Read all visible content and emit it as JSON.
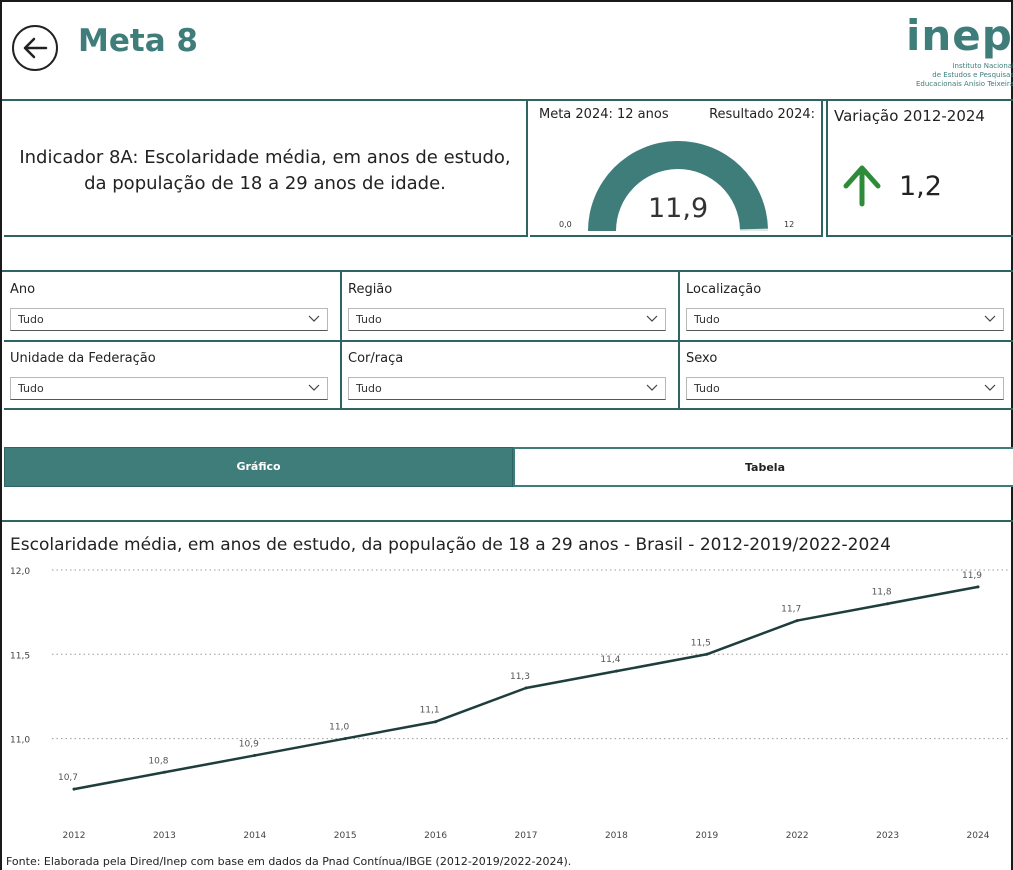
{
  "header": {
    "title": "Meta 8",
    "logo": {
      "mark": "inep",
      "lines": [
        "Instituto Nacional",
        "de Estudos e Pesquisas",
        "Educacionais Anísio Teixeira"
      ]
    }
  },
  "indicator": {
    "text": "Indicador 8A: Escolaridade média, em anos de estudo, da população de 18 a 29 anos de idade."
  },
  "gauge": {
    "meta_label": "Meta 2024: 12 anos",
    "result_label": "Resultado 2024:",
    "min_label": "0,0",
    "max_label": "12",
    "value_label": "11,9",
    "value": 11.9,
    "min": 0,
    "max": 12,
    "color": "#3f7d7a"
  },
  "variation": {
    "title": "Variação 2012-2024",
    "value": "1,2",
    "arrow_icon": "arrow-up-icon",
    "arrow_color": "#2e8b3a"
  },
  "filters": [
    {
      "label": "Ano",
      "value": "Tudo"
    },
    {
      "label": "Região",
      "value": "Tudo"
    },
    {
      "label": "Localização",
      "value": "Tudo"
    },
    {
      "label": "Unidade da Federação",
      "value": "Tudo"
    },
    {
      "label": "Cor/raça",
      "value": "Tudo"
    },
    {
      "label": "Sexo",
      "value": "Tudo"
    }
  ],
  "tabs": {
    "grafico": "Gráfico",
    "tabela": "Tabela"
  },
  "chart_title": "Escolaridade média, em anos de estudo, da população de 18 a 29 anos - Brasil - 2012-2019/2022-2024",
  "source": "Fonte: Elaborada pela Dired/Inep com base em dados da Pnad Contínua/IBGE (2012-2019/2022-2024).",
  "colors": {
    "accent": "#3f7d7a",
    "line": "#1e3d3d"
  },
  "chart_data": {
    "type": "line",
    "title": "Escolaridade média, em anos de estudo, da população de 18 a 29 anos - Brasil - 2012-2019/2022-2024",
    "categories": [
      "2012",
      "2013",
      "2014",
      "2015",
      "2016",
      "2017",
      "2018",
      "2019",
      "2022",
      "2023",
      "2024"
    ],
    "values": [
      10.7,
      10.8,
      10.9,
      11.0,
      11.1,
      11.3,
      11.4,
      11.5,
      11.7,
      11.8,
      11.9
    ],
    "value_labels": [
      "10,7",
      "10,8",
      "10,9",
      "11,0",
      "11,1",
      "11,3",
      "11,4",
      "11,5",
      "11,7",
      "11,8",
      "11,9"
    ],
    "yticks": [
      12.0,
      11.5,
      11.0
    ],
    "ytick_labels": [
      "12,0",
      "11,5",
      "11,0"
    ],
    "ylim": [
      10.6,
      12.0
    ],
    "grid": true,
    "xlabel": "",
    "ylabel": ""
  }
}
